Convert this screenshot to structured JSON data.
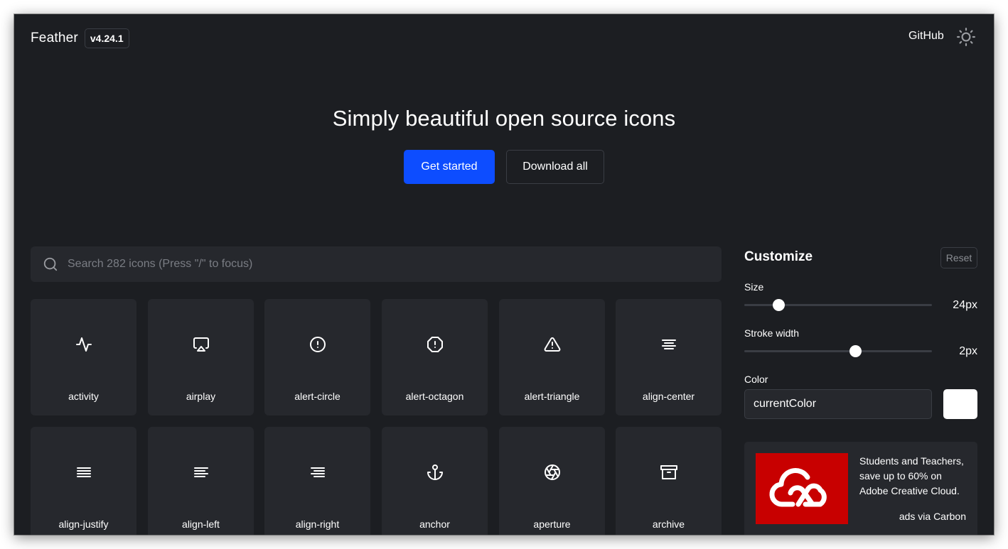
{
  "header": {
    "brand": "Feather",
    "version": "v4.24.1",
    "github_label": "GitHub",
    "theme_icon": "sun-icon"
  },
  "hero": {
    "title": "Simply beautiful open source icons",
    "primary_button": "Get started",
    "secondary_button": "Download all",
    "accent_color": "#0d4dff"
  },
  "search": {
    "placeholder": "Search 282 icons (Press \"/\" to focus)",
    "value": ""
  },
  "icons": [
    {
      "label": "activity",
      "icon": "activity-icon"
    },
    {
      "label": "airplay",
      "icon": "airplay-icon"
    },
    {
      "label": "alert-circle",
      "icon": "alert-circle-icon"
    },
    {
      "label": "alert-octagon",
      "icon": "alert-octagon-icon"
    },
    {
      "label": "alert-triangle",
      "icon": "alert-triangle-icon"
    },
    {
      "label": "align-center",
      "icon": "align-center-icon"
    },
    {
      "label": "align-justify",
      "icon": "align-justify-icon"
    },
    {
      "label": "align-left",
      "icon": "align-left-icon"
    },
    {
      "label": "align-right",
      "icon": "align-right-icon"
    },
    {
      "label": "anchor",
      "icon": "anchor-icon"
    },
    {
      "label": "aperture",
      "icon": "aperture-icon"
    },
    {
      "label": "archive",
      "icon": "archive-icon"
    }
  ],
  "customize": {
    "title": "Customize",
    "reset_label": "Reset",
    "size": {
      "label": "Size",
      "value_text": "24px",
      "fraction": 0.16
    },
    "stroke": {
      "label": "Stroke width",
      "value_text": "2px",
      "fraction": 0.6
    },
    "color": {
      "label": "Color",
      "value": "currentColor",
      "swatch": "#ffffff"
    }
  },
  "ad": {
    "text": "Students and Teachers, save up to 60% on Adobe Creative Cloud.",
    "via": "ads via Carbon",
    "image_icon": "adobe-creative-cloud-logo",
    "image_color": "#c80000"
  }
}
